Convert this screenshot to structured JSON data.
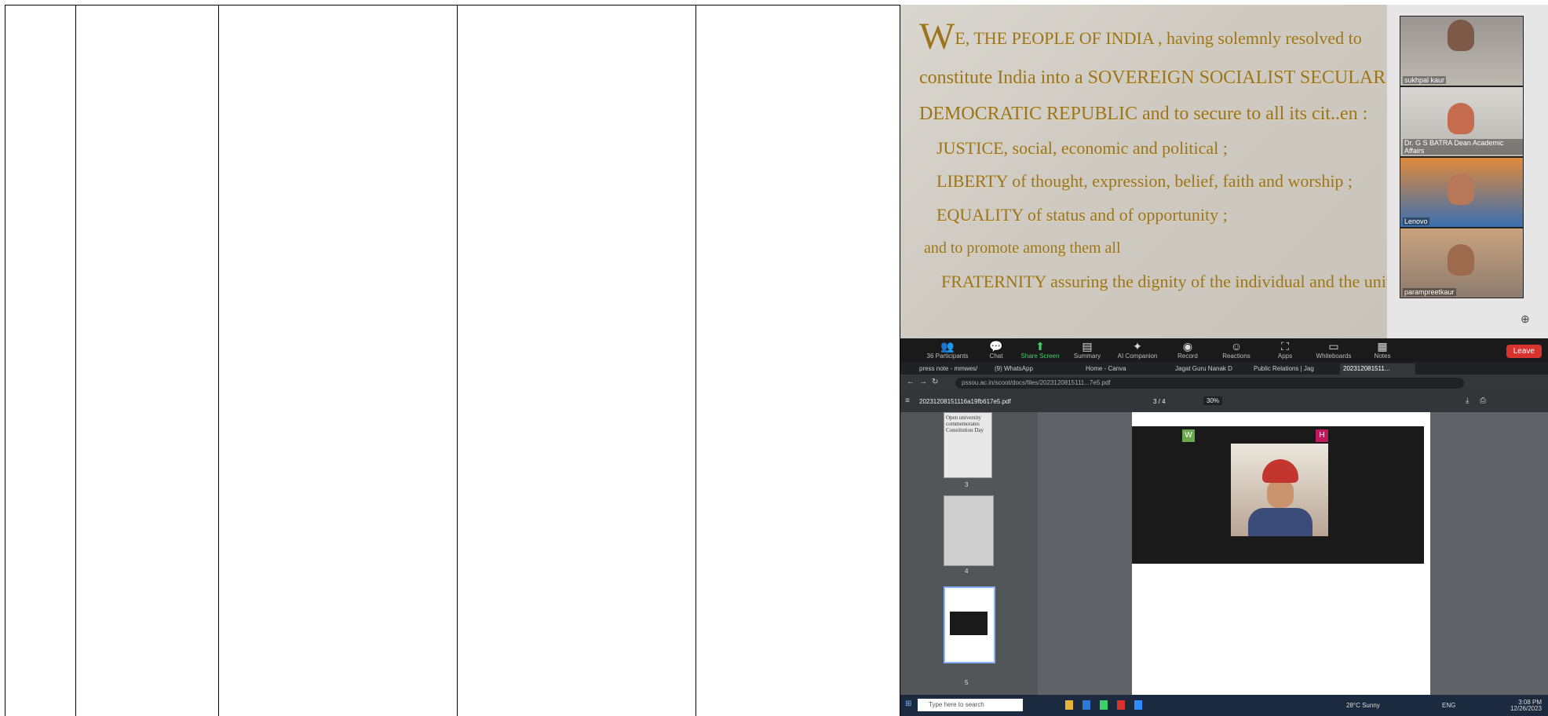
{
  "preamble": {
    "line1_initial": "W",
    "line1_rest": "E, THE PEOPLE OF INDIA , having solemnly resolved to",
    "line2": "constitute India into a SOVEREIGN SOCIALIST SECULAR",
    "line3": "DEMOCRATIC REPUBLIC and to secure to all its cit..en :",
    "line4": "JUSTICE, social, economic and political ;",
    "line5": "LIBERTY of thought, expression, belief, faith and worship ;",
    "line6": "EQUALITY of status and of opportunity ;",
    "line7": "and to promote among them all",
    "line8": "FRATERNITY assuring the dignity of the individual and the unity"
  },
  "participants": [
    {
      "name": "sukhpal kaur"
    },
    {
      "name": "Dr. G S BATRA Dean Academic Affairs"
    },
    {
      "name": "Lenovo"
    },
    {
      "name": "parampreetkaur"
    }
  ],
  "zoom_toolbar": {
    "participants_label": "Participants",
    "participants_count": "36",
    "chat_label": "Chat",
    "share_label": "Share Screen",
    "summary_label": "Summary",
    "ai_label": "AI Companion",
    "record_label": "Record",
    "reactions_label": "Reactions",
    "apps_label": "Apps",
    "whiteboards_label": "Whiteboards",
    "notes_label": "Notes",
    "leave_label": "Leave"
  },
  "browser": {
    "tabs": [
      "press note - mmwes/",
      "(9) WhatsApp",
      "Home - Canva",
      "Jagat Guru Nanak D",
      "Public Relations | Jag",
      "202312081511..."
    ],
    "url": "pssou.ac.in/scoot/docs/files/2023120815111...7e5.pdf",
    "pdf_title": "20231208151116a19fb617e5.pdf",
    "page_indicator": "3 / 4",
    "zoom_value": "30%",
    "thumb_numbers": [
      "3",
      "4",
      "5"
    ],
    "thumb1_text": "Open university commemorates Constitution Day"
  },
  "inner_zoom": {
    "tile1_letter": "W",
    "tile2_letter": "H"
  },
  "taskbar": {
    "search_placeholder": "Type here to search",
    "weather": "28°C Sunny",
    "time": "3:08 PM",
    "date": "12/26/2023",
    "lang": "ENG"
  },
  "colors": {
    "preamble_gold": "#9a7420",
    "share_green": "#3dd16a",
    "leave_red": "#d8332e",
    "taskbar": "#1b2a3f"
  }
}
